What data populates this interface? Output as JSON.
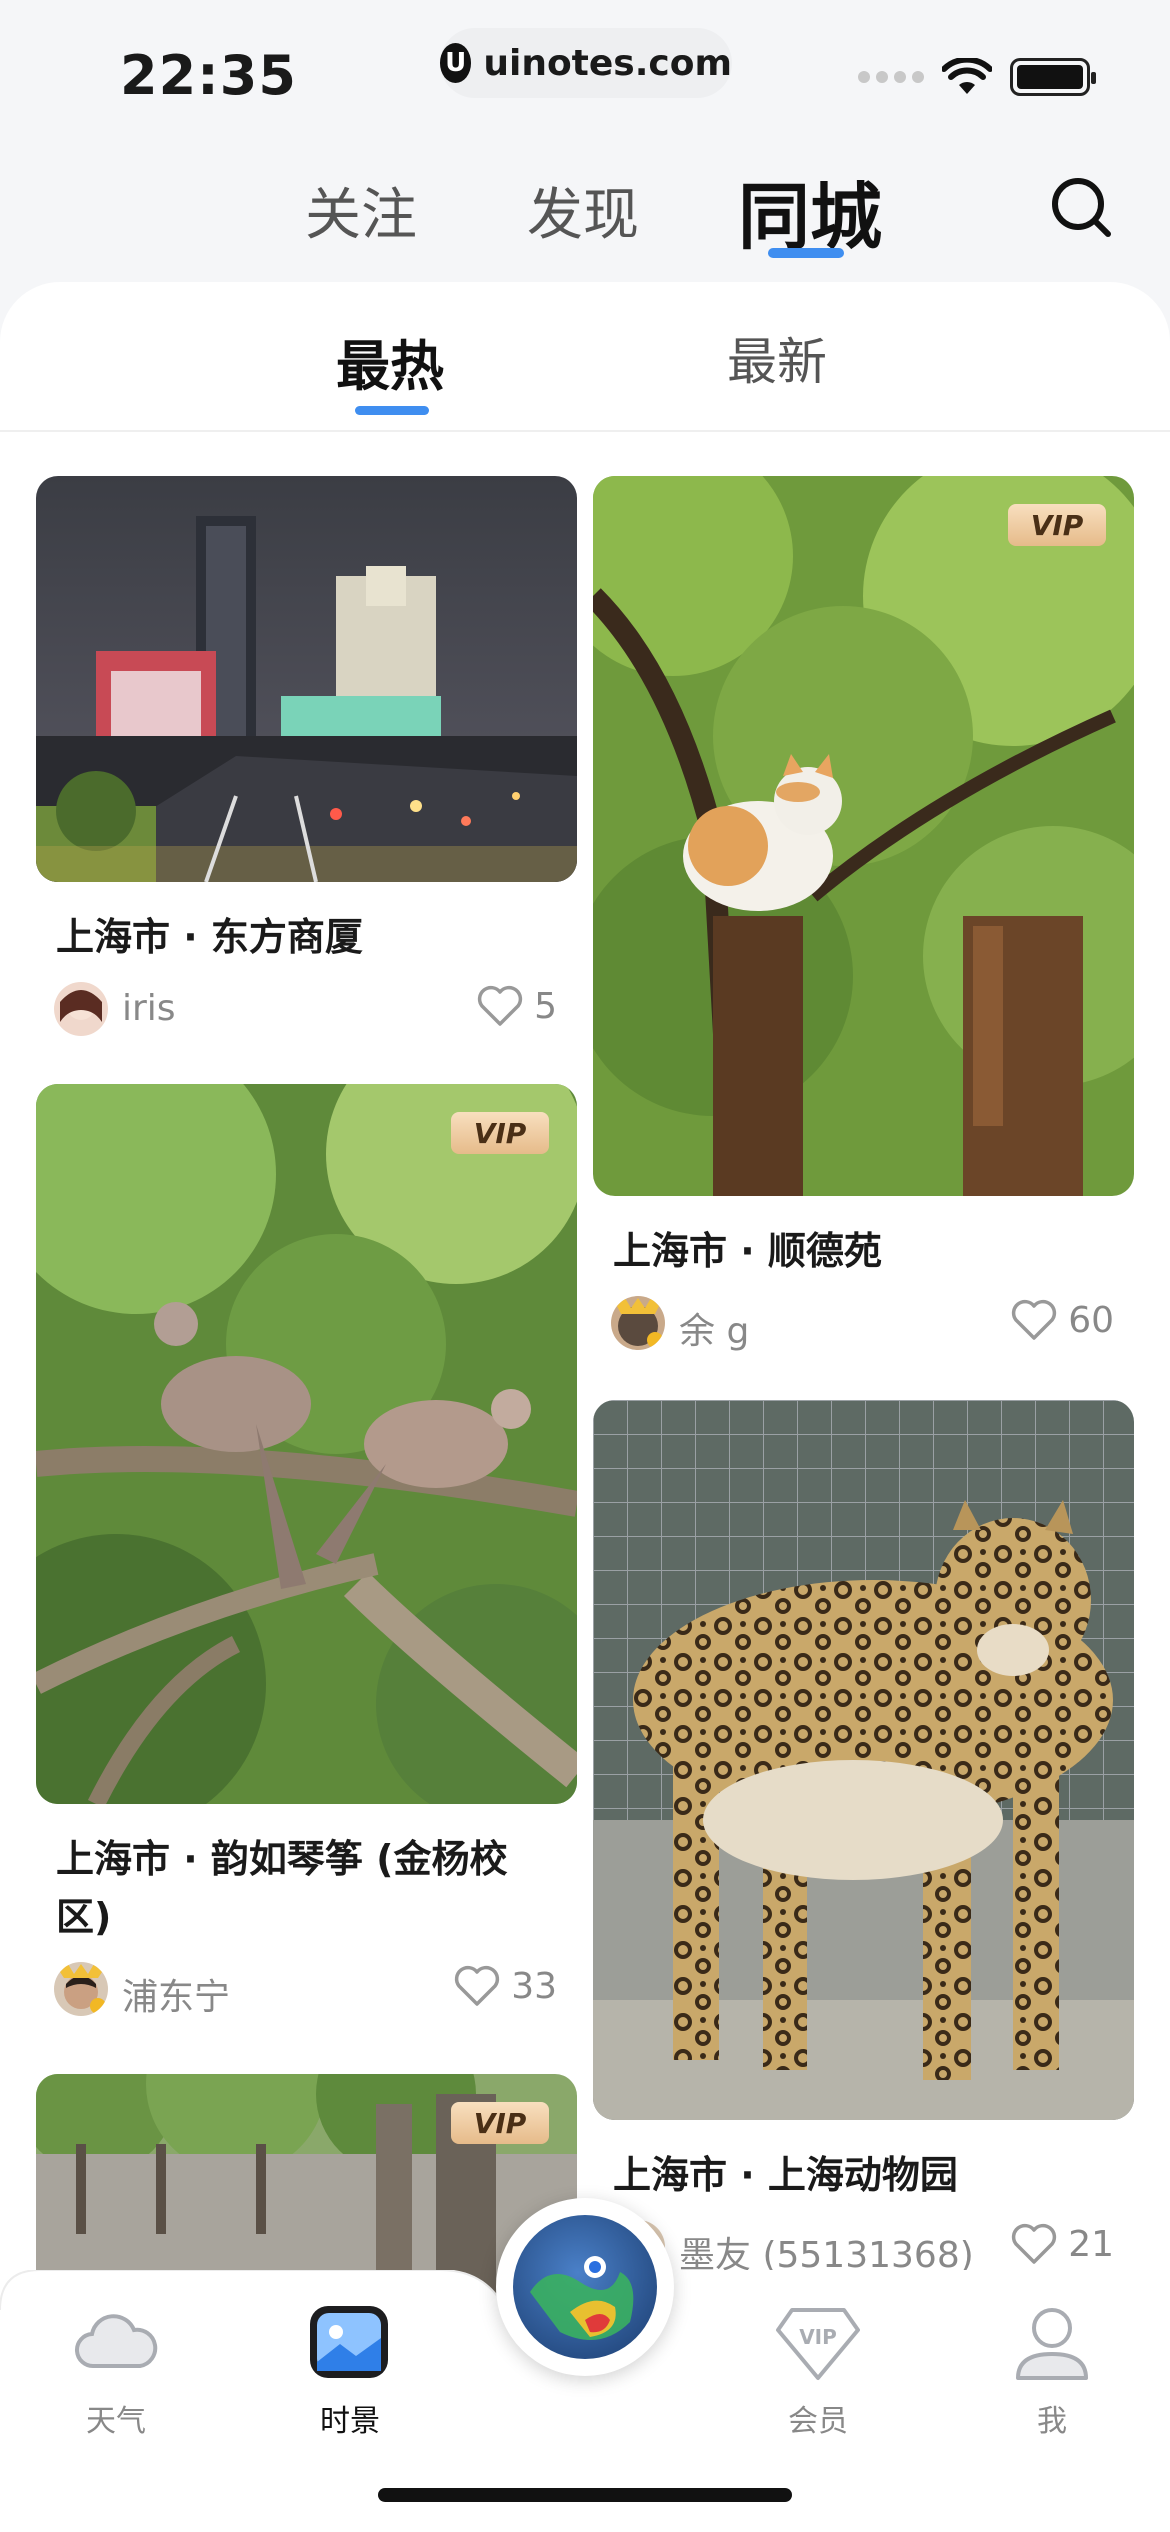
{
  "status": {
    "time": "22:35",
    "url": "uinotes.com"
  },
  "topnav": {
    "tabs": [
      "关注",
      "发现",
      "同城"
    ],
    "active": "同城"
  },
  "subtabs": {
    "hot": "最热",
    "latest": "最新"
  },
  "vip_label": "VIP",
  "cards": [
    {
      "title": "上海市 · 东方商厦",
      "user": "iris",
      "likes": "5"
    },
    {
      "title": "上海市 · 顺德苑",
      "user": "余 g",
      "likes": "60"
    },
    {
      "title": "上海市 · 韵如琴筝 (金杨校区)",
      "user": "浦东宁",
      "likes": "33"
    },
    {
      "title": "上海市 · 上海动物园",
      "user": "墨友 (55131368)",
      "likes": "21"
    }
  ],
  "tabbar": {
    "weather": "天气",
    "scenes": "时景",
    "vip": "会员",
    "me": "我"
  },
  "colors": {
    "accent": "#3f8ef0",
    "vip_gold": "#e6bb8a"
  }
}
